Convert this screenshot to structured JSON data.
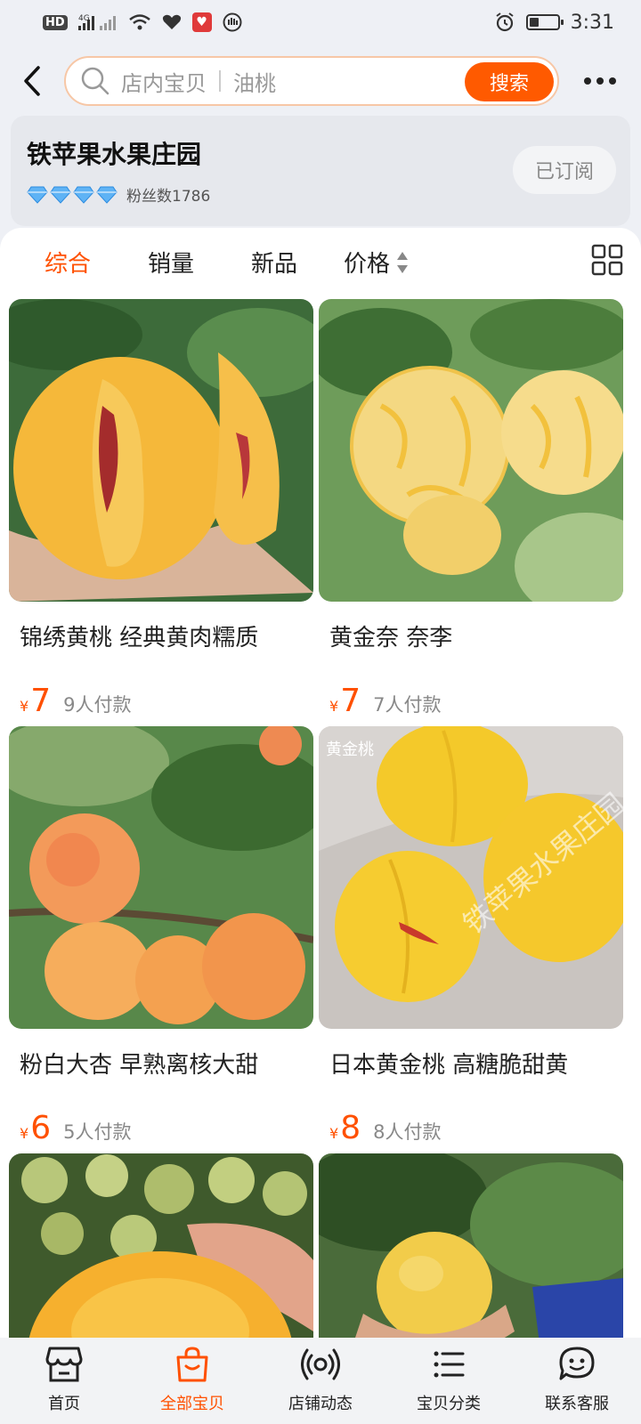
{
  "status_bar": {
    "time": "3:31",
    "network_labels": [
      "HD",
      "4G"
    ]
  },
  "search": {
    "scope_label": "店内宝贝",
    "query": "油桃",
    "submit_label": "搜索"
  },
  "shop": {
    "name": "铁苹果水果庄园",
    "diamond_count": 4,
    "fans_label": "粉丝数1786",
    "subscribe_label": "已订阅"
  },
  "sort_tabs": [
    {
      "label": "综合",
      "active": true
    },
    {
      "label": "销量",
      "active": false
    },
    {
      "label": "新品",
      "active": false
    },
    {
      "label": "价格",
      "active": false
    }
  ],
  "products": [
    {
      "title": "锦绣黄桃 经典黄肉糯质",
      "currency": "¥",
      "price": "7",
      "paid": "9人付款",
      "image_icon": "yellow-peach-cut"
    },
    {
      "title": "黄金奈 奈李",
      "currency": "¥",
      "price": "7",
      "paid": "7人付款",
      "image_icon": "golden-plum-tree"
    },
    {
      "title": "粉白大杏 早熟离核大甜",
      "currency": "¥",
      "price": "6",
      "paid": "5人付款",
      "image_icon": "apricot-tree"
    },
    {
      "title": "日本黄金桃 高糖脆甜黄",
      "currency": "¥",
      "price": "8",
      "paid": "8人付款",
      "image_icon": "golden-peach-table",
      "image_watermark": "铁苹果水果庄园",
      "image_caption": "黄金桃"
    },
    {
      "title": "",
      "currency": "",
      "price": "",
      "paid": "",
      "image_icon": "yellow-peach-cluster"
    },
    {
      "title": "",
      "currency": "",
      "price": "",
      "paid": "",
      "image_icon": "peach-in-hand"
    }
  ],
  "bottom_nav": [
    {
      "label": "首页",
      "icon": "shop-home-icon",
      "active": false
    },
    {
      "label": "全部宝贝",
      "icon": "shopping-bag-icon",
      "active": true
    },
    {
      "label": "店铺动态",
      "icon": "broadcast-icon",
      "active": false
    },
    {
      "label": "宝贝分类",
      "icon": "list-icon",
      "active": false
    },
    {
      "label": "联系客服",
      "icon": "chat-icon",
      "active": false
    }
  ],
  "colors": {
    "accent": "#ff5000",
    "search_button": "#ff5a00"
  }
}
